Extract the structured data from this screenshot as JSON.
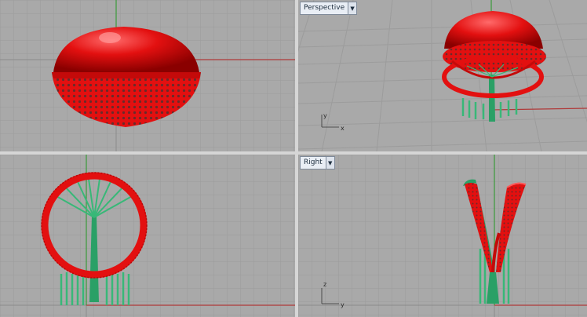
{
  "viewports": [
    {
      "id": "top",
      "label": ""
    },
    {
      "id": "perspective",
      "label": "Perspective"
    },
    {
      "id": "front",
      "label": ""
    },
    {
      "id": "right",
      "label": "Right"
    }
  ],
  "axes": {
    "perspective": {
      "x": "x",
      "y": "y"
    },
    "right": {
      "z": "z",
      "y": "y"
    }
  },
  "icons": {
    "dropdown": "chevron-down-icon"
  },
  "colors": {
    "viewport_bg": "#a9a9a9",
    "grid_line": "#9a9a9a",
    "x_axis": "#b03a3a",
    "y_axis": "#3a9a3a",
    "model_red": "#e31010",
    "model_green": "#38b878"
  }
}
